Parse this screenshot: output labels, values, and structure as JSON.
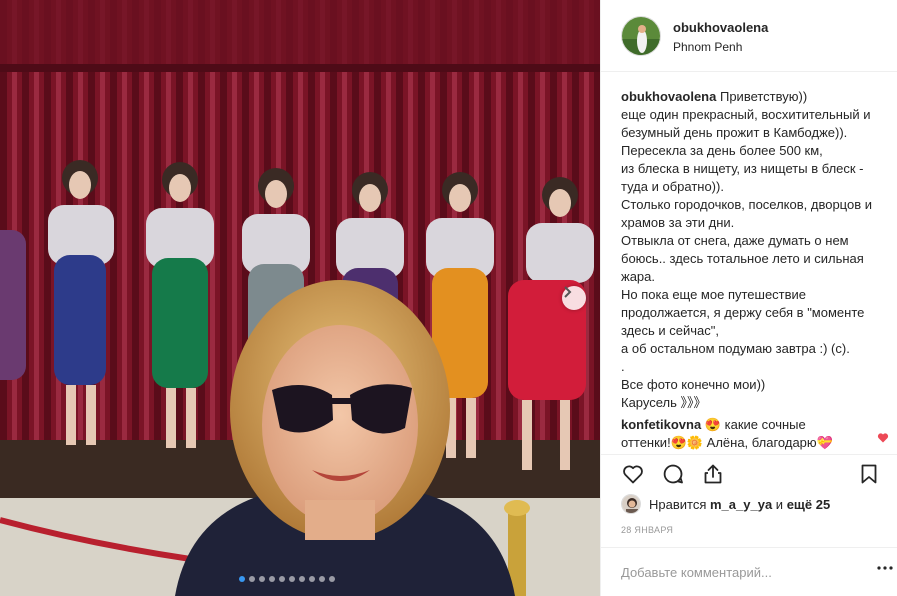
{
  "post": {
    "username": "obukhovaolena",
    "location": "Phnom Penh",
    "caption_lines": [
      "еще один прекрасный, восхитительный и",
      "безумный день прожит в Камбодже)).",
      "Пересекла за день более 500 км,",
      "из блеска в нищету, из нищеты в блеск -",
      "туда и обратно)).",
      "Столько городочков, поселков, дворцов и",
      "храмов за эти дни.",
      "Отвыкла от снега, даже думать о нем",
      "боюсь.. здесь тотальное лето и сильная",
      "жара.",
      "Но пока еще мое путешествие",
      "продолжается, я держу себя в \"моменте",
      "здесь и сейчас\",",
      "а об остальном подумаю завтра :) (с).",
      ".",
      "Все фото конечно мои))",
      "Карусель 》》》"
    ],
    "caption_first": "Приветствую))",
    "comment": {
      "username": "konfetikovna",
      "text_line1": "😍 какие сочные",
      "text_line2": "оттенки!😍🌼 Алёна, благодарю💝"
    },
    "likes": {
      "prefix": "Нравится",
      "user": "m_a_y_ya",
      "middle": "и",
      "rest": "ещё 25"
    },
    "date": "28 ЯНВАРЯ",
    "add_comment_placeholder": "Добавьте комментарий...",
    "carousel": {
      "total": 10,
      "active": 0
    },
    "colors": {
      "accent": "#3897f0",
      "like_red": "#ed4956",
      "curtain": "#7a1426"
    },
    "icons": [
      "heart-icon",
      "comment-icon",
      "share-icon",
      "bookmark-icon",
      "more-icon",
      "chevron-right-icon"
    ]
  }
}
